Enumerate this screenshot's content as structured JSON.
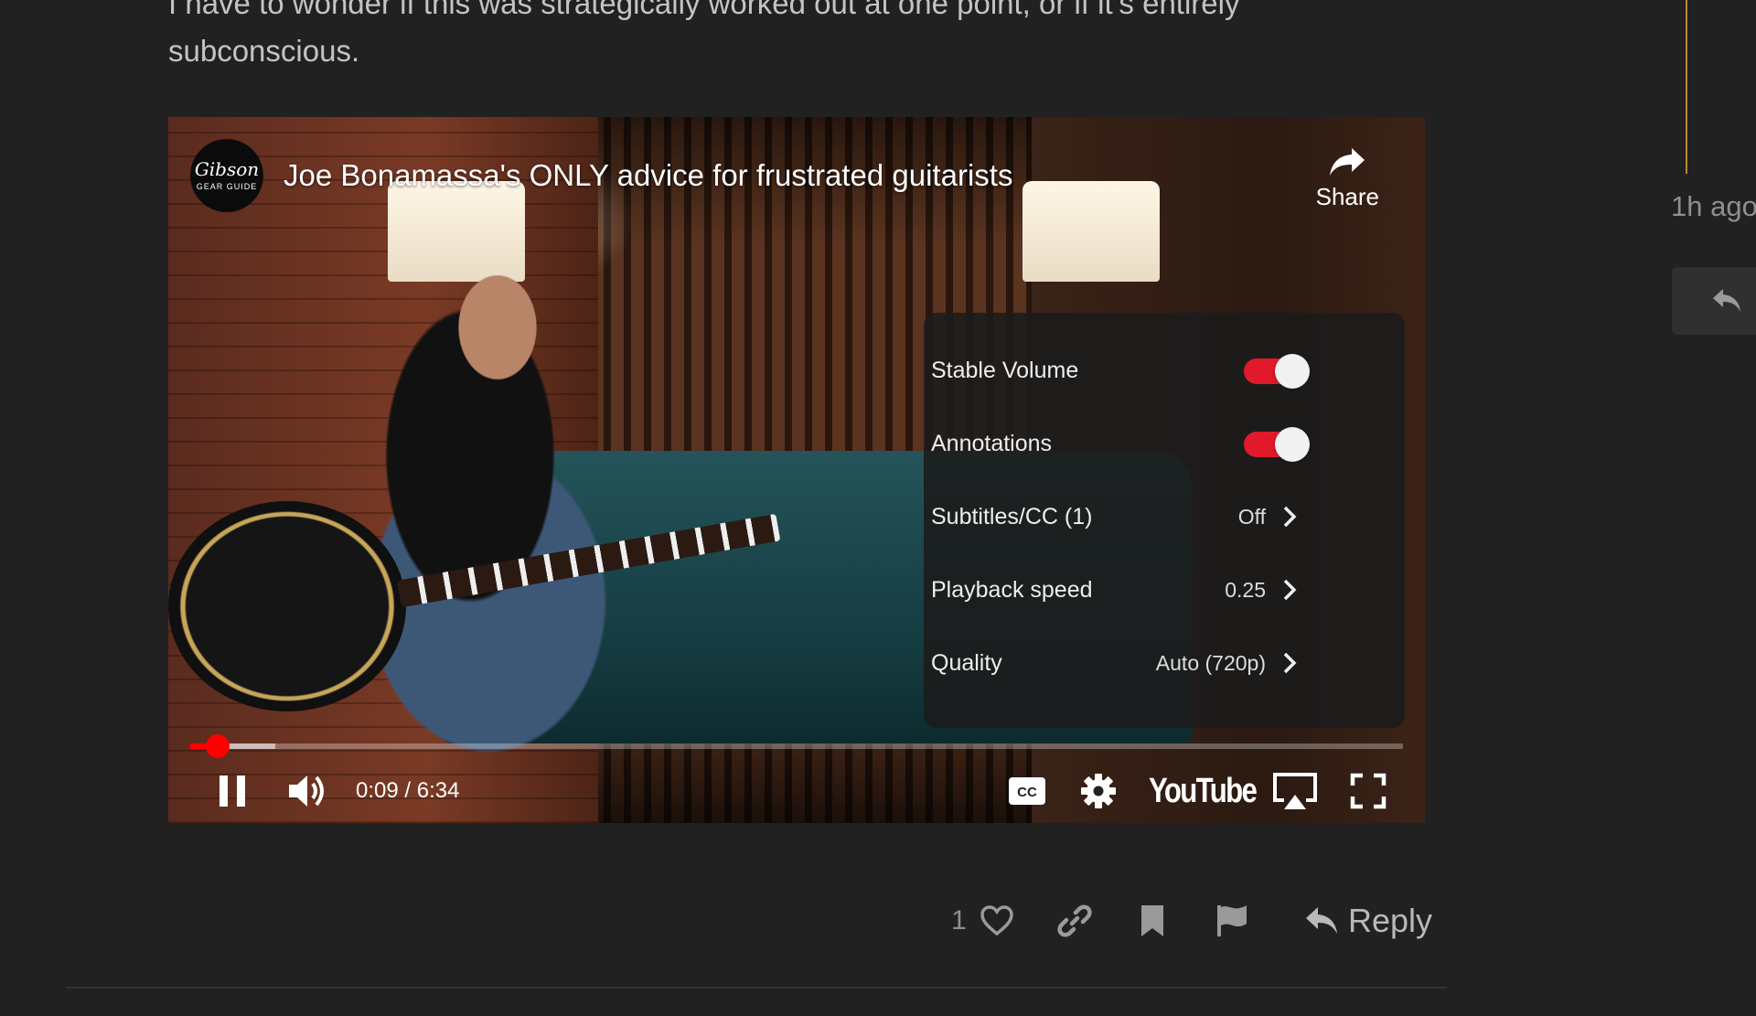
{
  "post": {
    "text": "I have to wonder if this was strategically worked out at one point, or if it’s entirely subconscious."
  },
  "timeline": {
    "date": "1h ago",
    "reply_icon": "reply-icon"
  },
  "video": {
    "title": "Joe Bonamassa's ONLY advice for frustrated guitarists",
    "channel_logo": {
      "brand": "Gibson",
      "subtitle": "GEAR GUIDE"
    },
    "share_label": "Share",
    "settings": {
      "stable_volume": {
        "label": "Stable Volume",
        "on": true
      },
      "annotations": {
        "label": "Annotations",
        "on": true
      },
      "subtitles": {
        "label": "Subtitles/CC (1)",
        "value": "Off"
      },
      "playback_speed": {
        "label": "Playback speed",
        "value": "0.25"
      },
      "quality": {
        "label": "Quality",
        "value": "Auto (720p)"
      }
    },
    "time_display": "0:09 / 6:34",
    "progress": {
      "played_fraction": 0.023,
      "loaded_fraction": 0.07
    },
    "youtube_label": "YouTube",
    "accent_color": "#ff0000",
    "controls_icons": [
      "pause-icon",
      "volume-icon",
      "cc-icon",
      "gear-icon",
      "airplay-icon",
      "fullscreen-icon"
    ]
  },
  "post_actions": {
    "like_count": "1",
    "reply_label": "Reply",
    "icons": [
      "heart-icon",
      "link-icon",
      "bookmark-icon",
      "flag-icon",
      "reply-icon"
    ]
  }
}
